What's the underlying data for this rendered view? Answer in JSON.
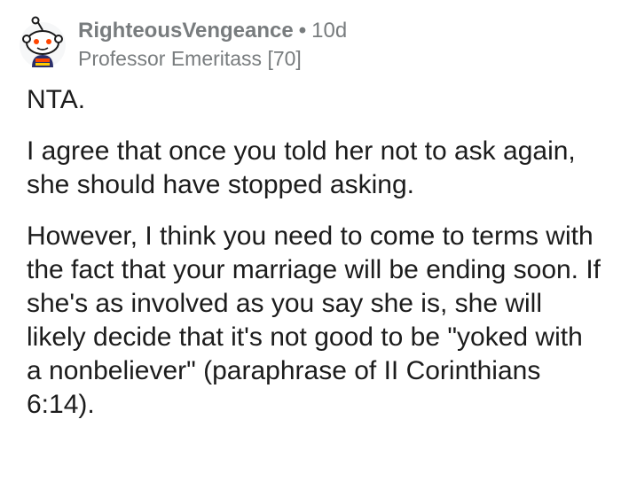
{
  "comment": {
    "author": "RighteousVengeance",
    "separator": "•",
    "age": "10d",
    "flair": "Professor Emeritass [70]",
    "paragraphs": [
      "NTA.",
      "I agree that once you told her not to ask again, she should have stopped asking.",
      "However, I think you need to come to terms with the fact that your marriage will be ending soon. If she's as involved as you say she is, she will likely decide that it's not good to be \"yoked with a nonbeliever\" (paraphrase of II Corinthians 6:14)."
    ]
  },
  "icons": {
    "avatar": "snoo-avatar-icon"
  },
  "colors": {
    "meta_text": "#787c7e",
    "body_text": "#1c1c1c",
    "background": "#ffffff",
    "avatar_accent": "#ff4500"
  }
}
